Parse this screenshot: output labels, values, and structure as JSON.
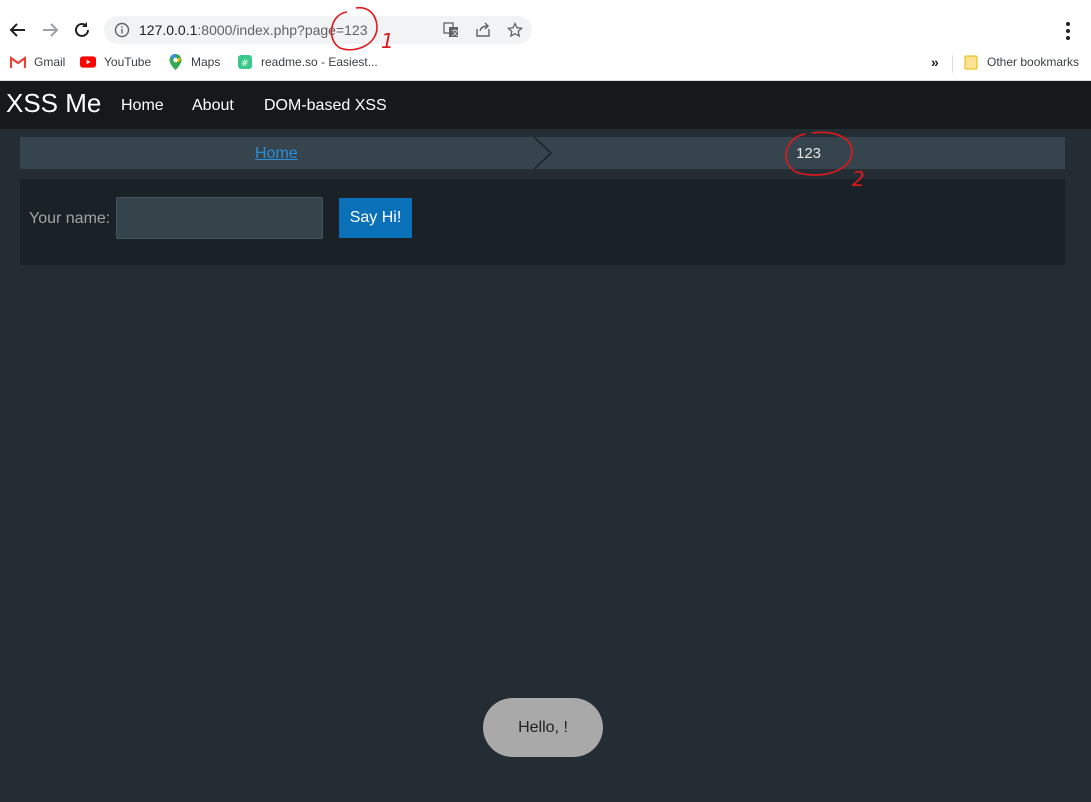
{
  "browser": {
    "url_host": "127.0.0.1",
    "url_rest": ":8000/index.php?page=123",
    "bookmarks": [
      {
        "label": "Gmail"
      },
      {
        "label": "YouTube"
      },
      {
        "label": "Maps"
      },
      {
        "label": "readme.so - Easiest..."
      }
    ],
    "more_bookmarks": "»",
    "other_bookmarks": "Other bookmarks"
  },
  "page": {
    "brand": "XSS Me",
    "nav": [
      "Home",
      "About",
      "DOM-based XSS"
    ],
    "breadcrumb": {
      "home": "Home",
      "current": "123"
    },
    "form": {
      "label": "Your name:",
      "input_value": "",
      "button": "Say Hi!"
    },
    "toast": "Hello, !"
  },
  "annotations": {
    "mark1": "1",
    "mark2": "2",
    "color": "#e0191d"
  }
}
